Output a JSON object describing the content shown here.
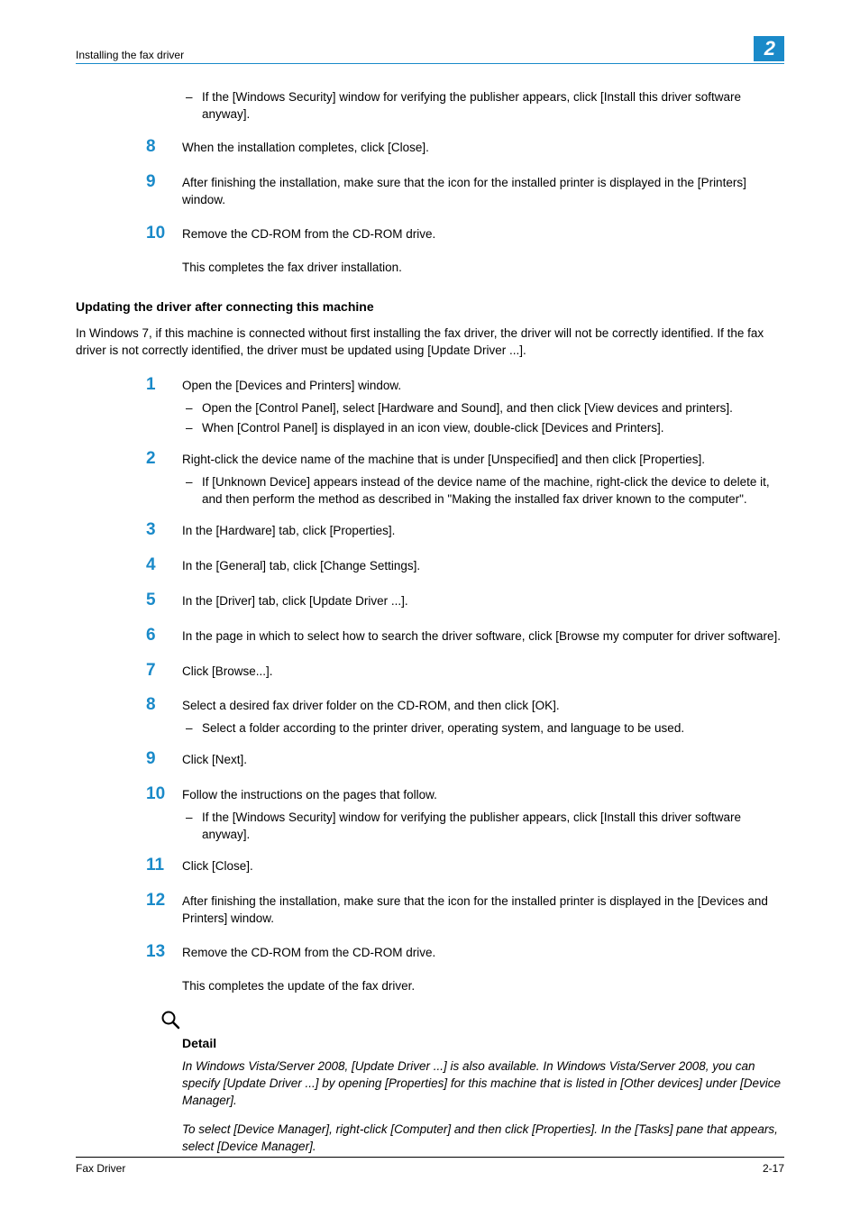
{
  "header": {
    "breadcrumb": "Installing the fax driver",
    "chapter_number": "2"
  },
  "block_a": {
    "intro_bullet": "If the [Windows Security] window for verifying the publisher appears, click [Install this driver software anyway].",
    "steps": [
      {
        "n": "8",
        "text": "When the installation completes, click [Close]."
      },
      {
        "n": "9",
        "text": "After finishing the installation, make sure that the icon for the installed printer is displayed in the [Printers] window."
      },
      {
        "n": "10",
        "text": "Remove the CD-ROM from the CD-ROM drive.",
        "follow": "This completes the fax driver installation."
      }
    ]
  },
  "section": {
    "heading": "Updating the driver after connecting this machine",
    "intro": "In Windows 7, if this machine is connected without first installing the fax driver, the driver will not be correctly identified. If the fax driver is not correctly identified, the driver must be updated using [Update Driver ...].",
    "steps": [
      {
        "n": "1",
        "text": "Open the [Devices and Printers] window.",
        "subs": [
          "Open the [Control Panel], select [Hardware and Sound], and then click [View devices and printers].",
          "When [Control Panel] is displayed in an icon view, double-click [Devices and Printers]."
        ]
      },
      {
        "n": "2",
        "text": "Right-click the device name of the machine that is under [Unspecified] and then click [Properties].",
        "subs": [
          "If [Unknown Device] appears instead of the device name of the machine, right-click the device to delete it, and then perform the method as described in \"Making the installed fax driver known to the computer\"."
        ]
      },
      {
        "n": "3",
        "text": "In the [Hardware] tab, click [Properties]."
      },
      {
        "n": "4",
        "text": "In the [General] tab, click [Change Settings]."
      },
      {
        "n": "5",
        "text": "In the [Driver] tab, click [Update Driver ...]."
      },
      {
        "n": "6",
        "text": "In the page in which to select how to search the driver software, click [Browse my computer for driver software]."
      },
      {
        "n": "7",
        "text": "Click [Browse...]."
      },
      {
        "n": "8",
        "text": "Select a desired fax driver folder on the CD-ROM, and then click [OK].",
        "subs": [
          "Select a folder according to the printer driver, operating system, and language to be used."
        ]
      },
      {
        "n": "9",
        "text": "Click [Next]."
      },
      {
        "n": "10",
        "text": "Follow the instructions on the pages that follow.",
        "subs": [
          "If the [Windows Security] window for verifying the publisher appears, click [Install this driver software anyway]."
        ]
      },
      {
        "n": "11",
        "text": "Click [Close]."
      },
      {
        "n": "12",
        "text": "After finishing the installation, make sure that the icon for the installed printer is displayed in the [Devices and Printers] window."
      },
      {
        "n": "13",
        "text": "Remove the CD-ROM from the CD-ROM drive.",
        "follow": "This completes the update of the fax driver."
      }
    ]
  },
  "detail": {
    "label": "Detail",
    "para1": "In Windows Vista/Server 2008, [Update Driver ...] is also available. In Windows Vista/Server 2008, you can specify [Update Driver ...] by opening [Properties] for this machine that is listed in [Other devices] under [Device Manager].",
    "para2": "To select [Device Manager], right-click [Computer] and then click [Properties]. In the [Tasks] pane that appears, select [Device Manager]."
  },
  "footer": {
    "left": "Fax Driver",
    "right": "2-17"
  }
}
